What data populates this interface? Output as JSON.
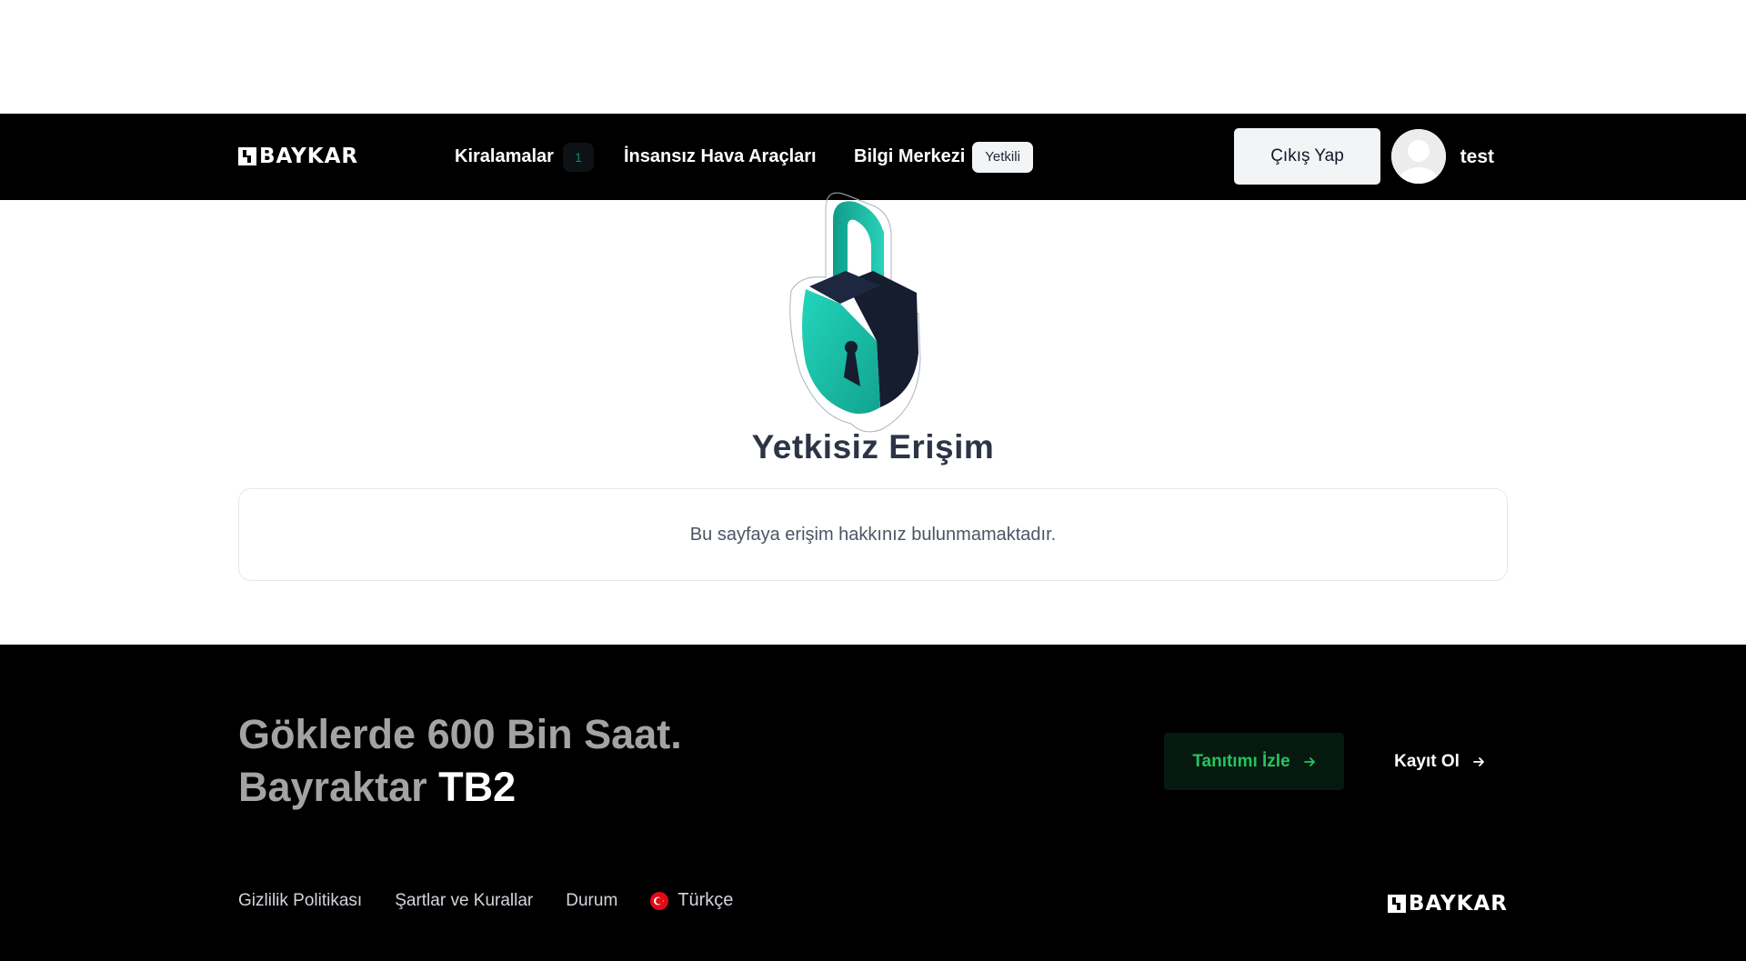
{
  "header": {
    "logo_text": "BAYKAR",
    "nav": {
      "rentals_label": "Kiralamalar",
      "rentals_count": "1",
      "uav_label": "İnsansız Hava Araçları",
      "info_center_label": "Bilgi Merkezi",
      "info_center_badge": "Yetkili"
    },
    "logout_label": "Çıkış Yap",
    "username": "test"
  },
  "main": {
    "icon": "padlock-illustration",
    "title": "Yetkisiz Erişim",
    "message": "Bu sayfaya erişim hakkınız bulunmamaktadır."
  },
  "footer": {
    "tagline_line1": "Göklerde 600 Bin Saat.",
    "tagline_line2_prefix": "Bayraktar",
    "tagline_line2_highlight": "TB2",
    "watch_label": "Tanıtımı İzle",
    "signup_label": "Kayıt Ol",
    "links": {
      "privacy": "Gizlilik Politikası",
      "terms": "Şartlar ve Kurallar",
      "status": "Durum"
    },
    "language": "Türkçe",
    "logo_text": "BAYKAR"
  },
  "colors": {
    "navbar_bg": "#000000",
    "accent_green": "#22c55e",
    "lock_teal": "#1ecfb3",
    "lock_navy": "#151d2f"
  }
}
